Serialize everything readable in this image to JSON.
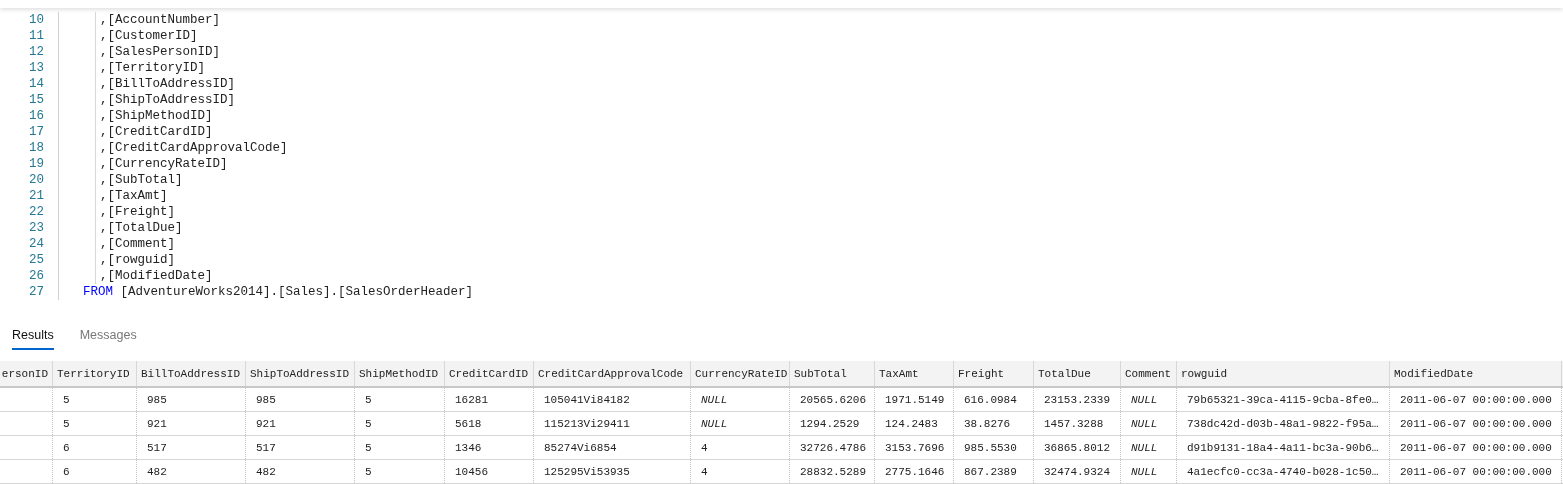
{
  "editor": {
    "lines": [
      {
        "number": "10",
        "kind": "column",
        "text": ",[AccountNumber]"
      },
      {
        "number": "11",
        "kind": "column",
        "text": ",[CustomerID]"
      },
      {
        "number": "12",
        "kind": "column",
        "text": ",[SalesPersonID]"
      },
      {
        "number": "13",
        "kind": "column",
        "text": ",[TerritoryID]"
      },
      {
        "number": "14",
        "kind": "column",
        "text": ",[BillToAddressID]"
      },
      {
        "number": "15",
        "kind": "column",
        "text": ",[ShipToAddressID]"
      },
      {
        "number": "16",
        "kind": "column",
        "text": ",[ShipMethodID]"
      },
      {
        "number": "17",
        "kind": "column",
        "text": ",[CreditCardID]"
      },
      {
        "number": "18",
        "kind": "column",
        "text": ",[CreditCardApprovalCode]"
      },
      {
        "number": "19",
        "kind": "column",
        "text": ",[CurrencyRateID]"
      },
      {
        "number": "20",
        "kind": "column",
        "text": ",[SubTotal]"
      },
      {
        "number": "21",
        "kind": "column",
        "text": ",[TaxAmt]"
      },
      {
        "number": "22",
        "kind": "column",
        "text": ",[Freight]"
      },
      {
        "number": "23",
        "kind": "column",
        "text": ",[TotalDue]"
      },
      {
        "number": "24",
        "kind": "column",
        "text": ",[Comment]"
      },
      {
        "number": "25",
        "kind": "column",
        "text": ",[rowguid]"
      },
      {
        "number": "26",
        "kind": "column",
        "text": ",[ModifiedDate]"
      },
      {
        "number": "27",
        "kind": "clause",
        "keyword": "FROM",
        "text": " [AdventureWorks2014].[Sales].[SalesOrderHeader]"
      }
    ]
  },
  "results_tabs": [
    {
      "label": "Results",
      "selected": true
    },
    {
      "label": "Messages",
      "selected": false
    }
  ],
  "table": {
    "columns": [
      "ersonID",
      "TerritoryID",
      "BillToAddressID",
      "ShipToAddressID",
      "ShipMethodID",
      "CreditCardID",
      "CreditCardApprovalCode",
      "CurrencyRateID",
      "SubTotal",
      "TaxAmt",
      "Freight",
      "TotalDue",
      "Comment",
      "rowguid",
      "ModifiedDate"
    ],
    "rows": [
      [
        "",
        "5",
        "985",
        "985",
        "5",
        "16281",
        "105041Vi84182",
        {
          "value": "NULL",
          "kind": "null"
        },
        "20565.6206",
        "1971.5149",
        "616.0984",
        "23153.2339",
        {
          "value": "NULL",
          "kind": "null"
        },
        "79b65321-39ca-4115-9cba-8fe0…",
        "2011-06-07 00:00:00.000"
      ],
      [
        "",
        "5",
        "921",
        "921",
        "5",
        "5618",
        "115213Vi29411",
        {
          "value": "NULL",
          "kind": "null"
        },
        "1294.2529",
        "124.2483",
        "38.8276",
        "1457.3288",
        {
          "value": "NULL",
          "kind": "null"
        },
        "738dc42d-d03b-48a1-9822-f95a…",
        "2011-06-07 00:00:00.000"
      ],
      [
        "",
        "6",
        "517",
        "517",
        "5",
        "1346",
        "85274Vi6854",
        "4",
        "32726.4786",
        "3153.7696",
        "985.5530",
        "36865.8012",
        {
          "value": "NULL",
          "kind": "null"
        },
        "d91b9131-18a4-4a11-bc3a-90b6…",
        "2011-06-07 00:00:00.000"
      ],
      [
        "",
        "6",
        "482",
        "482",
        "5",
        "10456",
        "125295Vi53935",
        "4",
        "28832.5289",
        "2775.1646",
        "867.2389",
        "32474.9324",
        {
          "value": "NULL",
          "kind": "null"
        },
        "4a1ecfc0-cc3a-4740-b028-1c50…",
        "2011-06-07 00:00:00.000"
      ]
    ]
  }
}
